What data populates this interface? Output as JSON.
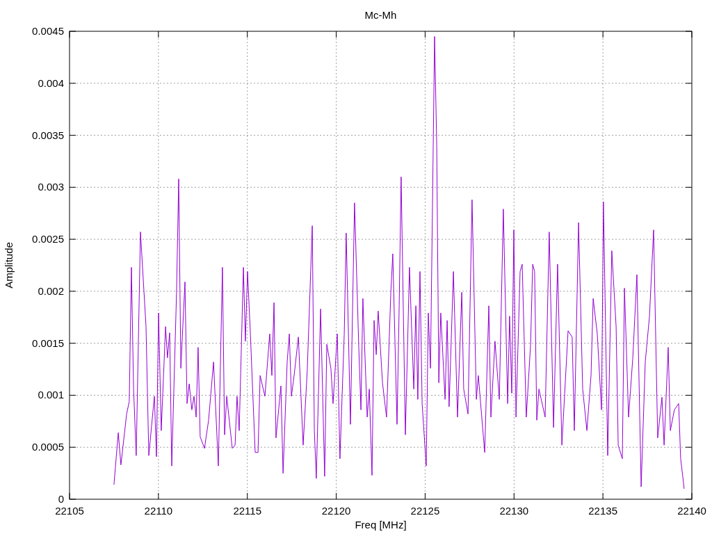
{
  "chart": {
    "chart_data": {
      "type": "line",
      "title": "Mc-Mh",
      "xlabel": "Freq [MHz]",
      "ylabel": "Amplitude",
      "grid": true,
      "xlim": [
        22105,
        22140
      ],
      "ylim": [
        0,
        0.0045
      ],
      "xticks": [
        22105,
        22110,
        22115,
        22120,
        22125,
        22130,
        22135,
        22140
      ],
      "yticks": [
        0,
        0.0005,
        0.001,
        0.0015,
        0.002,
        0.0025,
        0.003,
        0.0035,
        0.004,
        0.0045
      ],
      "x": [
        22107.5,
        22107.74,
        22107.89,
        22108.21,
        22108.36,
        22108.48,
        22108.6,
        22108.75,
        22108.99,
        22109.3,
        22109.46,
        22109.77,
        22109.89,
        22110.01,
        22110.16,
        22110.4,
        22110.51,
        22110.63,
        22110.75,
        22111.02,
        22111.14,
        22111.26,
        22111.49,
        22111.61,
        22111.73,
        22111.88,
        22112.0,
        22112.12,
        22112.23,
        22112.35,
        22112.59,
        22112.82,
        22113.1,
        22113.37,
        22113.6,
        22113.72,
        22113.84,
        22114.15,
        22114.31,
        22114.42,
        22114.54,
        22114.78,
        22114.89,
        22115.01,
        22115.17,
        22115.44,
        22115.6,
        22115.72,
        22115.99,
        22116.26,
        22116.38,
        22116.5,
        22116.61,
        22116.89,
        22117.01,
        22117.24,
        22117.36,
        22117.48,
        22117.63,
        22117.87,
        22118.14,
        22118.37,
        22118.65,
        22118.77,
        22118.88,
        22119.12,
        22119.35,
        22119.47,
        22119.7,
        22119.82,
        22120.06,
        22120.21,
        22120.45,
        22120.56,
        22120.8,
        22121.03,
        22121.27,
        22121.39,
        22121.5,
        22121.74,
        22121.86,
        22122.01,
        22122.13,
        22122.25,
        22122.36,
        22122.6,
        22122.83,
        22123.07,
        22123.18,
        22123.42,
        22123.54,
        22123.65,
        22123.89,
        22124.12,
        22124.36,
        22124.48,
        22124.59,
        22124.71,
        22124.83,
        22125.06,
        22125.18,
        22125.3,
        22125.53,
        22125.65,
        22125.77,
        22125.88,
        22126.12,
        22126.24,
        22126.35,
        22126.59,
        22126.82,
        22127.06,
        22127.17,
        22127.41,
        22127.64,
        22127.88,
        22127.99,
        22128.35,
        22128.58,
        22128.7,
        22128.93,
        22129.17,
        22129.4,
        22129.64,
        22129.75,
        22129.87,
        22129.99,
        22130.11,
        22130.34,
        22130.46,
        22130.69,
        22130.93,
        22131.05,
        22131.16,
        22131.28,
        22131.4,
        22131.75,
        22131.98,
        22132.22,
        22132.45,
        22132.69,
        22133.04,
        22133.27,
        22133.39,
        22133.63,
        22133.86,
        22134.1,
        22134.33,
        22134.45,
        22134.68,
        22134.92,
        22135.03,
        22135.27,
        22135.5,
        22135.74,
        22135.86,
        22136.09,
        22136.21,
        22136.44,
        22136.68,
        22136.91,
        22137.15,
        22137.38,
        22137.62,
        22137.85,
        22138.08,
        22138.32,
        22138.44,
        22138.67,
        22138.79,
        22139.02,
        22139.26,
        22139.37,
        22139.57
      ],
      "series": [
        {
          "color": "#9400d3",
          "values": [
            0.00014,
            0.00064,
            0.00033,
            0.00082,
            0.00094,
            0.00223,
            0.00106,
            0.00042,
            0.00257,
            0.00166,
            0.00042,
            0.00099,
            0.00041,
            0.00179,
            0.00066,
            0.00166,
            0.00136,
            0.0016,
            0.00032,
            0.00199,
            0.00308,
            0.00126,
            0.00209,
            0.00092,
            0.00111,
            0.00086,
            0.00099,
            0.00079,
            0.00146,
            0.0006,
            0.00049,
            0.00076,
            0.00132,
            0.00032,
            0.00223,
            0.00062,
            0.00099,
            0.00049,
            0.00052,
            0.00099,
            0.00066,
            0.00223,
            0.00152,
            0.00219,
            0.00159,
            0.00045,
            0.00045,
            0.00119,
            0.00099,
            0.00159,
            0.00119,
            0.00189,
            0.00059,
            0.00109,
            0.00025,
            0.00132,
            0.00159,
            0.00099,
            0.00119,
            0.00156,
            0.00052,
            0.00124,
            0.00263,
            0.00066,
            0.0002,
            0.00183,
            0.00022,
            0.00149,
            0.00126,
            0.00092,
            0.00159,
            0.00039,
            0.00159,
            0.00256,
            0.00072,
            0.00285,
            0.00146,
            0.00086,
            0.00193,
            0.00079,
            0.00106,
            0.00023,
            0.00172,
            0.00139,
            0.00181,
            0.00112,
            0.00079,
            0.00199,
            0.00236,
            0.00072,
            0.00186,
            0.0031,
            0.00062,
            0.00223,
            0.00106,
            0.00186,
            0.00096,
            0.00219,
            0.00092,
            0.00032,
            0.00179,
            0.00126,
            0.00445,
            0.0034,
            0.00112,
            0.00179,
            0.00096,
            0.00172,
            0.00089,
            0.00219,
            0.00079,
            0.00199,
            0.00106,
            0.00082,
            0.00288,
            0.00096,
            0.00119,
            0.00045,
            0.00186,
            0.00079,
            0.00152,
            0.00096,
            0.00279,
            0.00092,
            0.00176,
            0.00102,
            0.00259,
            0.00079,
            0.00219,
            0.00226,
            0.00079,
            0.00149,
            0.00226,
            0.00219,
            0.00076,
            0.00106,
            0.00079,
            0.00257,
            0.00069,
            0.00226,
            0.00052,
            0.00162,
            0.00156,
            0.00066,
            0.00266,
            0.00106,
            0.00066,
            0.00119,
            0.00193,
            0.00159,
            0.00086,
            0.00286,
            0.00042,
            0.00239,
            0.00166,
            0.00052,
            0.00039,
            0.00203,
            0.00079,
            0.00136,
            0.00216,
            0.00012,
            0.00132,
            0.00176,
            0.00259,
            0.00059,
            0.00098,
            0.00052,
            0.00146,
            0.00066,
            0.00086,
            0.00092,
            0.00039,
            0.0001
          ]
        }
      ]
    }
  }
}
